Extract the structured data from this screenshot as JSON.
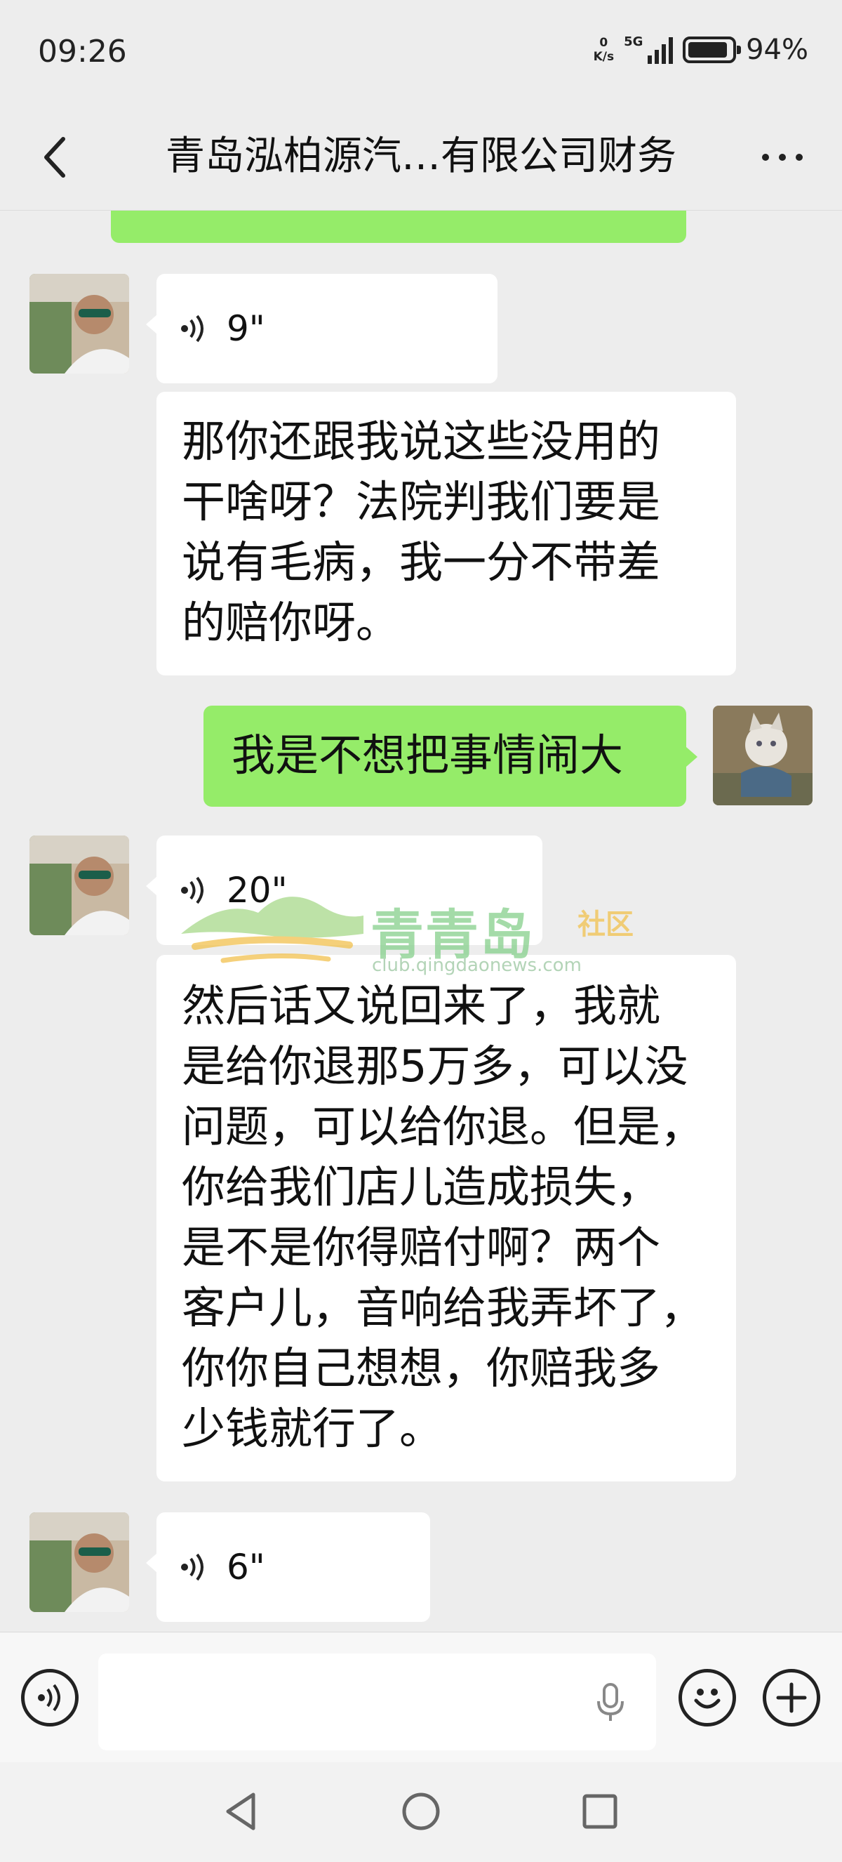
{
  "status_bar": {
    "time": "09:26",
    "net_speed_value": "0",
    "net_speed_unit": "K/s",
    "network": "5G",
    "battery": "94%"
  },
  "header": {
    "title": "青岛泓柏源汽…有限公司财务"
  },
  "messages": [
    {
      "side": "right",
      "type": "text",
      "text": "",
      "note": "partially scrolled-off bubble"
    },
    {
      "side": "left",
      "type": "voice",
      "duration": "9\""
    },
    {
      "side": "left",
      "type": "text",
      "text": "那你还跟我说这些没用的\n干啥呀？法院判我们要是\n说有毛病，我一分不带差\n的赔你呀。"
    },
    {
      "side": "right",
      "type": "text",
      "text": "我是不想把事情闹大"
    },
    {
      "side": "left",
      "type": "voice",
      "duration": "20\""
    },
    {
      "side": "left",
      "type": "text",
      "text": "然后话又说回来了，我就\n是给你退那5万多，可以没\n问题，可以给你退。但是，\n你给我们店儿造成损失，\n是不是你得赔付啊？两个\n客户儿，音响给我弄坏了，\n你你自己想想，你赔我多\n少钱就行了。"
    },
    {
      "side": "left",
      "type": "voice",
      "duration": "6\""
    }
  ],
  "watermark": {
    "name": "青青岛",
    "suffix": "社区",
    "url": "club.qingdaonews.com"
  },
  "icons": {
    "back": "chevron-left-icon",
    "more": "more-dots-icon",
    "voice_toggle": "voice-mode-icon",
    "mic": "microphone-icon",
    "emoji": "emoji-icon",
    "plus": "plus-icon"
  },
  "colors": {
    "background": "#ededed",
    "outgoing_bubble": "#95ec69",
    "incoming_bubble": "#ffffff"
  }
}
